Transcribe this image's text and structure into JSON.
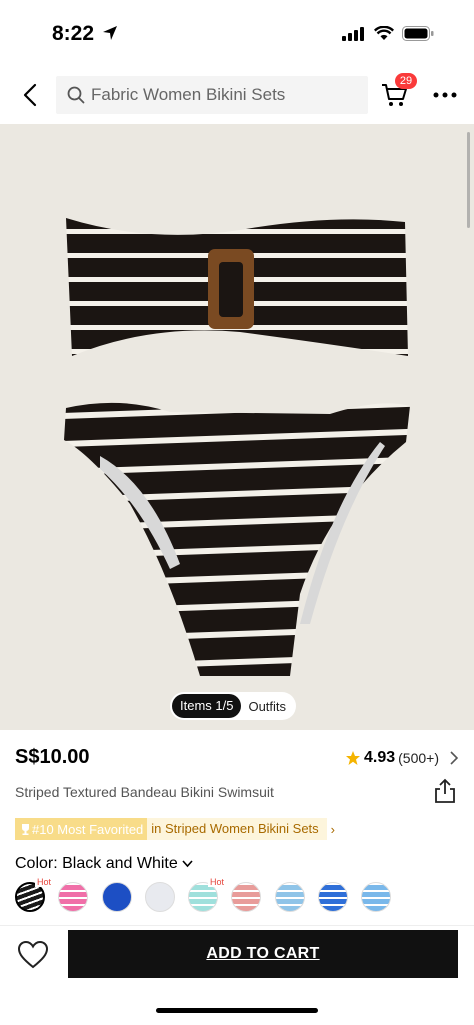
{
  "status": {
    "time": "8:22"
  },
  "header": {
    "search_text": "Fabric Women Bikini Sets",
    "cart_count": "29"
  },
  "gallery": {
    "tab_items": "Items 1/5",
    "tab_outfits": "Outfits"
  },
  "product": {
    "price": "S$10.00",
    "rating": "4.93",
    "rating_count": "(500+)",
    "title": "Striped Textured Bandeau Bikini Swimsuit",
    "rank_badge": "#10 Most Favorited",
    "rank_category": "in Striped Women Bikini Sets",
    "color_label": "Color: Black and White",
    "hot_label": "Hot"
  },
  "colors": {
    "rating_star": "#f5b400",
    "rank_gold": "#a86a00",
    "badge_red": "#fa3a3a",
    "swatches": [
      "#1a1a1a",
      "#f06fa8",
      "#1d4fc4",
      "#e8eaef",
      "#9fe0dc",
      "#e89c9a",
      "#8fc4e8",
      "#2f6fd8",
      "#7ab8ea"
    ]
  },
  "actions": {
    "add_to_cart": "ADD TO CART"
  }
}
